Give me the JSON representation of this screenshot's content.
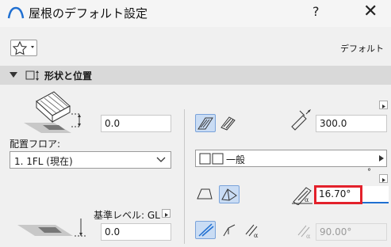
{
  "window": {
    "title": "屋根のデフォルト設定",
    "help_label": "?",
    "close_label": "✕"
  },
  "toolbar": {
    "favorites_icon": "star-icon",
    "default_label": "デフォルト"
  },
  "section": {
    "label": "形状と位置",
    "expanded": true
  },
  "left_panel": {
    "top_offset_value": "0.0",
    "home_story_label": "配置フロア:",
    "home_story_value": "1. 1FL (現在)",
    "reference_level_label": "基準レベル: GL",
    "reference_offset_value": "0.0"
  },
  "right_panel": {
    "thickness_value": "300.0",
    "layer_structure_label": "一般",
    "degree_unit": "°",
    "pitch_value": "16.70°",
    "angle_value": "90.00°"
  },
  "colors": {
    "accent": "#1f6fd1",
    "highlight_box": "#e3212b",
    "selected_tool_bg": "#c9dcf4"
  }
}
